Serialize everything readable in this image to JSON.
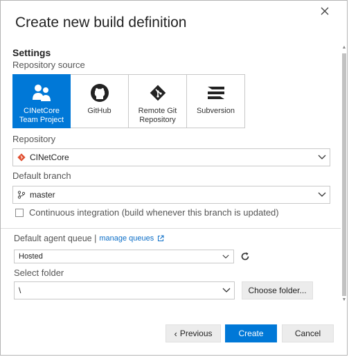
{
  "dialog": {
    "title": "Create new build definition"
  },
  "settings": {
    "section_title": "Settings",
    "repo_source_label": "Repository source",
    "sources": [
      {
        "label": "CINetCore Team Project",
        "icon": "team-project-icon",
        "selected": true
      },
      {
        "label": "GitHub",
        "icon": "github-icon",
        "selected": false
      },
      {
        "label": "Remote Git Repository",
        "icon": "git-icon",
        "selected": false
      },
      {
        "label": "Subversion",
        "icon": "subversion-icon",
        "selected": false
      }
    ],
    "repository_label": "Repository",
    "repository_value": "CINetCore",
    "branch_label": "Default branch",
    "branch_value": "master",
    "ci_label": "Continuous integration (build whenever this branch is updated)",
    "ci_checked": false
  },
  "agent": {
    "queue_label": "Default agent queue |",
    "manage_link": "manage queues",
    "queue_value": "Hosted",
    "folder_label": "Select folder",
    "folder_value": "\\",
    "choose_folder": "Choose folder..."
  },
  "footer": {
    "previous": "Previous",
    "previous_glyph": "‹",
    "create": "Create",
    "cancel": "Cancel"
  },
  "colors": {
    "accent": "#0078d7",
    "link": "#0a6dc7",
    "git_red": "#e04e2f"
  }
}
